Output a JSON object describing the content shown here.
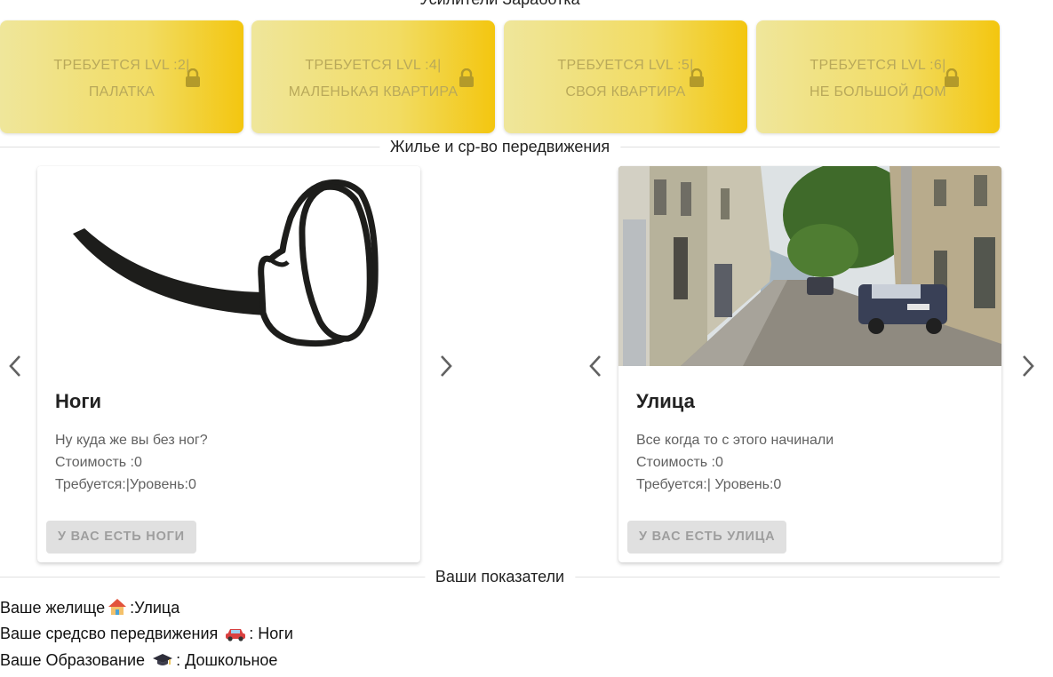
{
  "boosters": {
    "title": "Усилители Заработка",
    "items": [
      {
        "required": "ТРЕБУЕТСЯ LVL :2|",
        "name": "ПАЛАТКА"
      },
      {
        "required": "ТРЕБУЕТСЯ LVL :4|",
        "name": "МАЛЕНЬКАЯ КВАРТИРА"
      },
      {
        "required": "ТРЕБУЕТСЯ LVL :5|",
        "name": "СВОЯ КВАРТИРА"
      },
      {
        "required": "ТРЕБУЕТСЯ LVL :6|",
        "name": "НЕ БОЛЬШОЙ ДОМ"
      }
    ]
  },
  "housing": {
    "title": "Жилье и ср-во передвижения",
    "cards": [
      {
        "title": "Ноги",
        "description": "Ну куда же вы без ног?",
        "cost": "Стоимость :0",
        "requirement": "Требуется:|Уровень:0",
        "button": "У ВАС ЕСТЬ НОГИ",
        "image": "legs-illustration"
      },
      {
        "title": "Улица",
        "description": "Все когда то с этого начинали",
        "cost": "Стоимость :0",
        "requirement": "Требуется:| Уровень:0",
        "button": "У ВАС ЕСТЬ УЛИЦА",
        "image": "street-photo"
      }
    ]
  },
  "stats": {
    "title": "Ваши показатели",
    "housing_label": "Ваше желище",
    "housing_value": ":Улица",
    "transport_label": "Ваше средсво передвижения",
    "transport_value": ": Ноги",
    "education_label": "Ваше Образование",
    "education_value": ": Дошкольное"
  },
  "icons": {
    "lock": "lock-icon",
    "prev": "chevron-left-icon",
    "next": "chevron-right-icon",
    "house": "house-emoji",
    "car": "car-emoji",
    "graduation": "graduation-cap-emoji"
  },
  "colors": {
    "accent_yellow": "#f3c60f",
    "button_disabled": "#e0e0e0"
  }
}
